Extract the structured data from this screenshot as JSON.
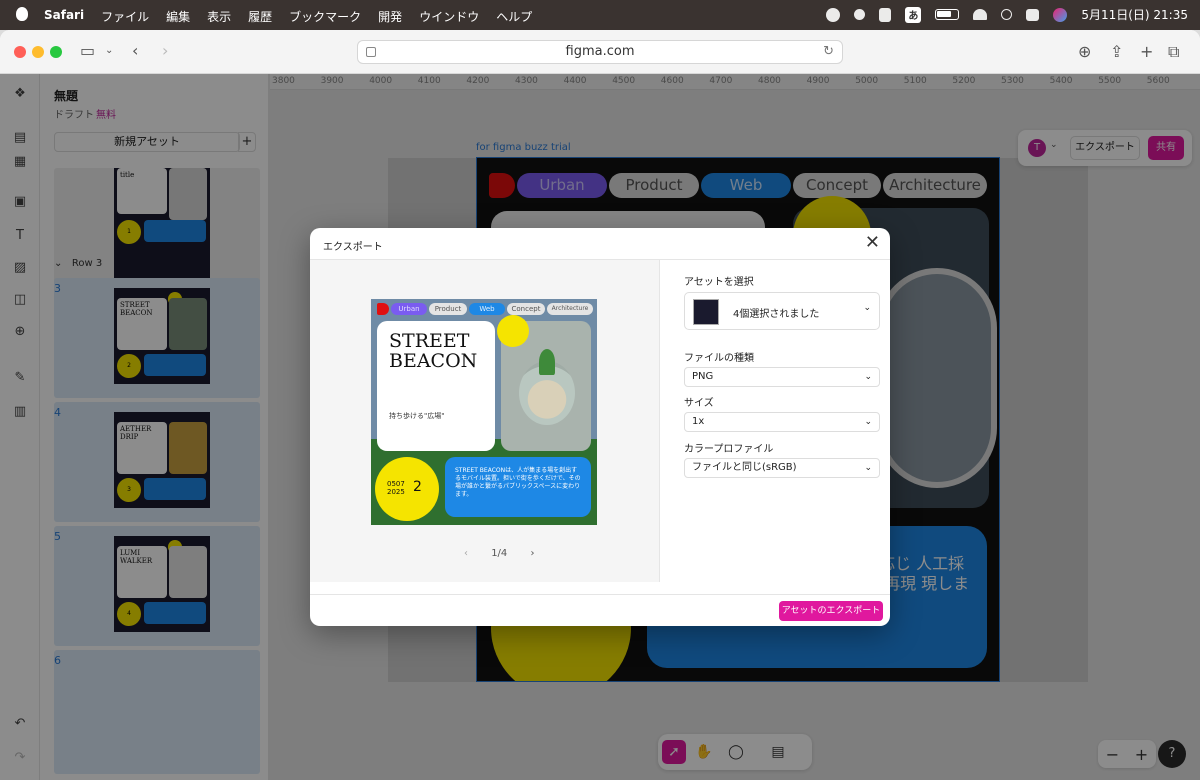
{
  "menubar": {
    "app": "Safari",
    "items": [
      "ファイル",
      "編集",
      "表示",
      "履歴",
      "ブックマーク",
      "開発",
      "ウインドウ",
      "ヘルプ"
    ],
    "ime": "あ",
    "datetime": "5月11日(日)  21:35"
  },
  "browser": {
    "url": "figma.com"
  },
  "figma": {
    "file_name": "無題",
    "draft_label": "ドラフト",
    "plan_label": "無料",
    "new_asset_label": "新規アセット",
    "row_label": "Row 3",
    "slots": [
      {
        "num": "3",
        "thumb_title": "STREET BEACON",
        "badge": "2"
      },
      {
        "num": "4",
        "thumb_title": "AETHER DRIP",
        "badge": "3"
      },
      {
        "num": "5",
        "thumb_title": "LUMI WALKER",
        "badge": "4"
      },
      {
        "num": "6"
      }
    ],
    "top_thumb_title": "title",
    "top_thumb_badge": "1",
    "ruler_ticks": [
      "3800",
      "3900",
      "4000",
      "4100",
      "4200",
      "4300",
      "4400",
      "4500",
      "4600",
      "4700",
      "4800",
      "4900",
      "5000",
      "5100",
      "5200",
      "5300",
      "5400",
      "5500",
      "5600"
    ],
    "frame_label": "for figma buzz trial",
    "frame_pills": [
      "Urban",
      "Product",
      "Web",
      "Concept",
      "Architecture"
    ],
    "frame_blue_text": "度に応じ 人工採光 を再現 現しま す。",
    "avatar_letter": "T",
    "export_label": "エクスポート",
    "share_label": "共有",
    "zoom_minus": "−",
    "zoom_plus": "+",
    "help": "?"
  },
  "export_dialog": {
    "title": "エクスポート",
    "preview": {
      "pills": [
        "Urban",
        "Product",
        "Web",
        "Concept",
        "Architecture"
      ],
      "title": "STREET\nBEACON",
      "subtitle": "持ち歩ける\"広場\"",
      "date_line1": "0507",
      "date_line2": "2025",
      "number": "2",
      "body": "STREET BEACONは、人が集まる場を創出するモバイル装置。担いで街を歩くだけで、その場が誰かと繋がるパブリックスペースに変わります。"
    },
    "pager": "1/4",
    "asset_label": "アセットを選択",
    "asset_value": "4個選択されました",
    "filetype_label": "ファイルの種類",
    "filetype_value": "PNG",
    "size_label": "サイズ",
    "size_value": "1x",
    "profile_label": "カラープロファイル",
    "profile_value": "ファイルと同じ(sRGB)",
    "export_button": "アセットのエクスポート"
  },
  "colors": {
    "accent": "#e0189e",
    "figma_blue": "#2a7ad6",
    "yellow": "#f5e400",
    "card_blue": "#1e88e5",
    "pill_purple": "#7a5cf0"
  }
}
